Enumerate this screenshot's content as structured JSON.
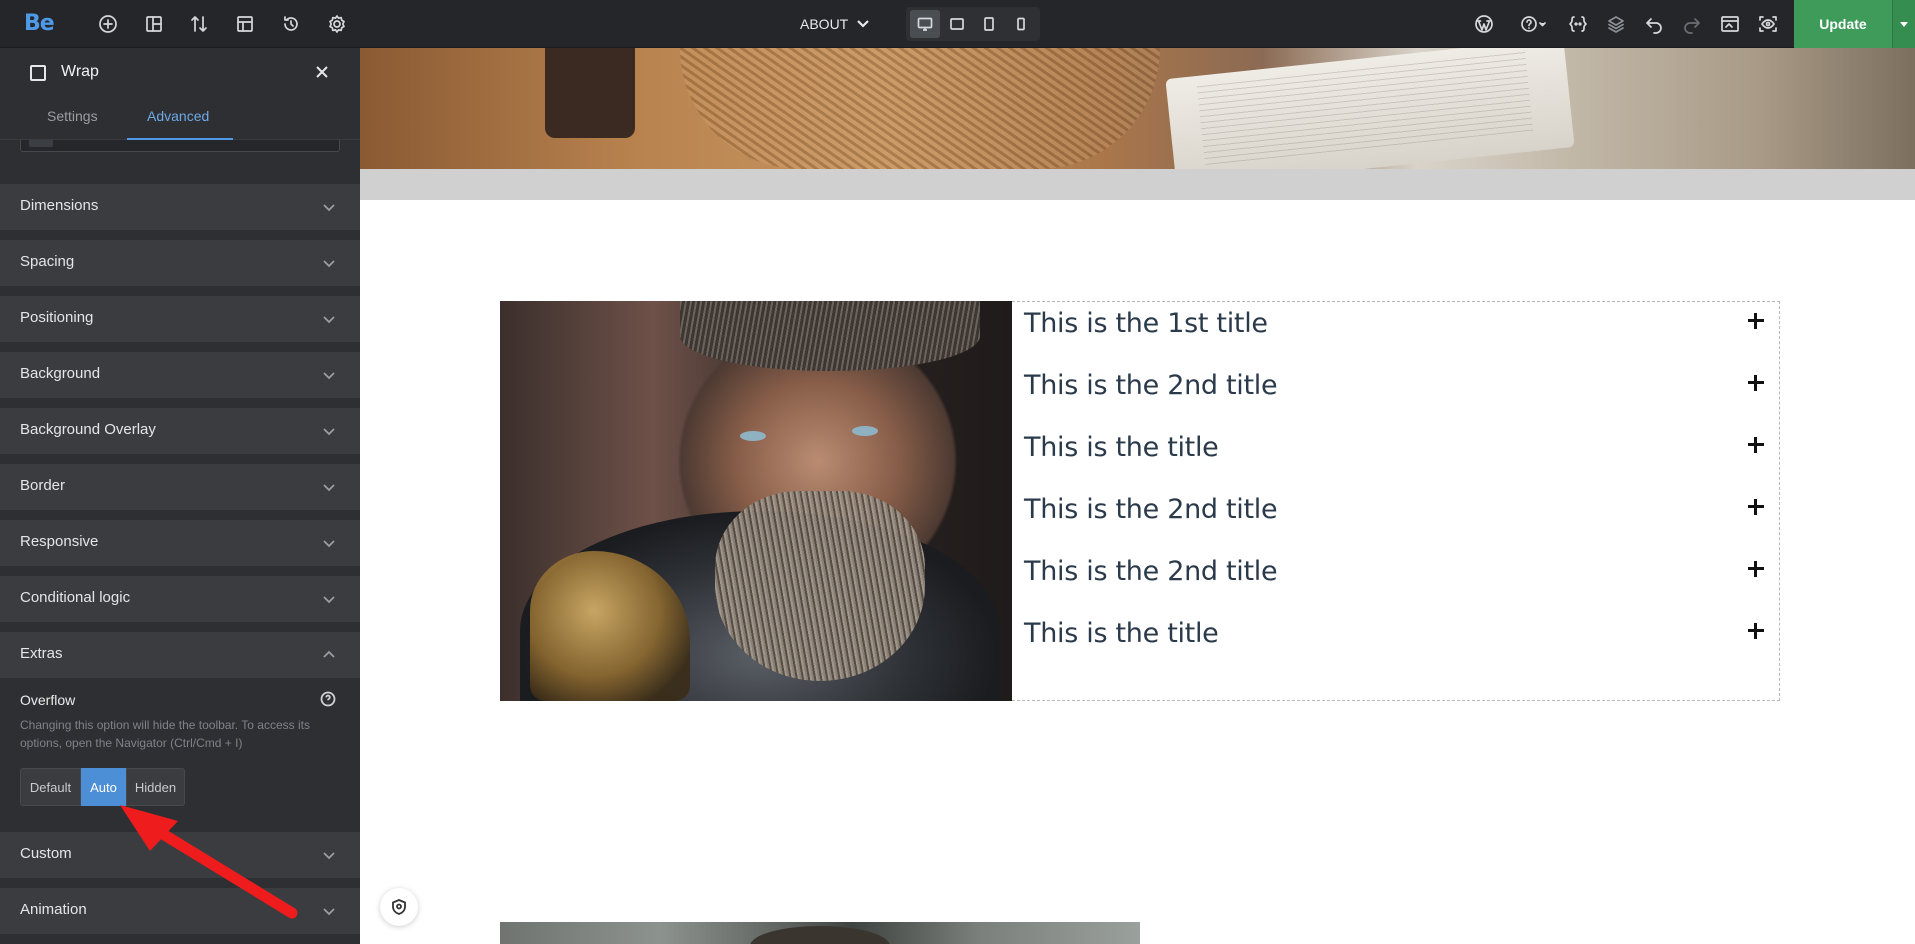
{
  "app": {
    "logo": "Be",
    "page_selector": "ABOUT",
    "update_label": "Update"
  },
  "toolbar_icons": [
    "add-icon",
    "layout-icon",
    "sort-icon",
    "template-icon",
    "history-icon",
    "settings-icon"
  ],
  "right_icons": [
    "wordpress-icon",
    "help-icon",
    "dynamic-data-icon",
    "layers-icon",
    "undo-icon",
    "redo-icon",
    "preview-toggle-icon",
    "eye-icon"
  ],
  "devices": [
    "desktop",
    "laptop",
    "tablet",
    "mobile"
  ],
  "panel": {
    "title": "Wrap",
    "tabs": [
      {
        "label": "Settings",
        "active": false
      },
      {
        "label": "Advanced",
        "active": true
      }
    ],
    "sections": [
      "Dimensions",
      "Spacing",
      "Positioning",
      "Background",
      "Background Overlay",
      "Border",
      "Responsive",
      "Conditional logic",
      "Extras",
      "Custom",
      "Animation"
    ],
    "extras": {
      "overflow_label": "Overflow",
      "overflow_description": "Changing this option will hide the toolbar. To access its options, open the Navigator (Ctrl/Cmd + I)",
      "options": [
        {
          "label": "Default",
          "active": false
        },
        {
          "label": "Auto",
          "active": true
        },
        {
          "label": "Hidden",
          "active": false
        }
      ]
    }
  },
  "accordion": {
    "items": [
      "This is the 1st title",
      "This is the 2nd title",
      "This is the title",
      "This is the 2nd title",
      "This is the 2nd title",
      "This is the title"
    ]
  },
  "colors": {
    "topbar": "#242629",
    "panel": "#2d2f32",
    "accent": "#4f9ae8",
    "update": "#3f9b5a",
    "annotation_arrow": "#ee1c1c"
  }
}
